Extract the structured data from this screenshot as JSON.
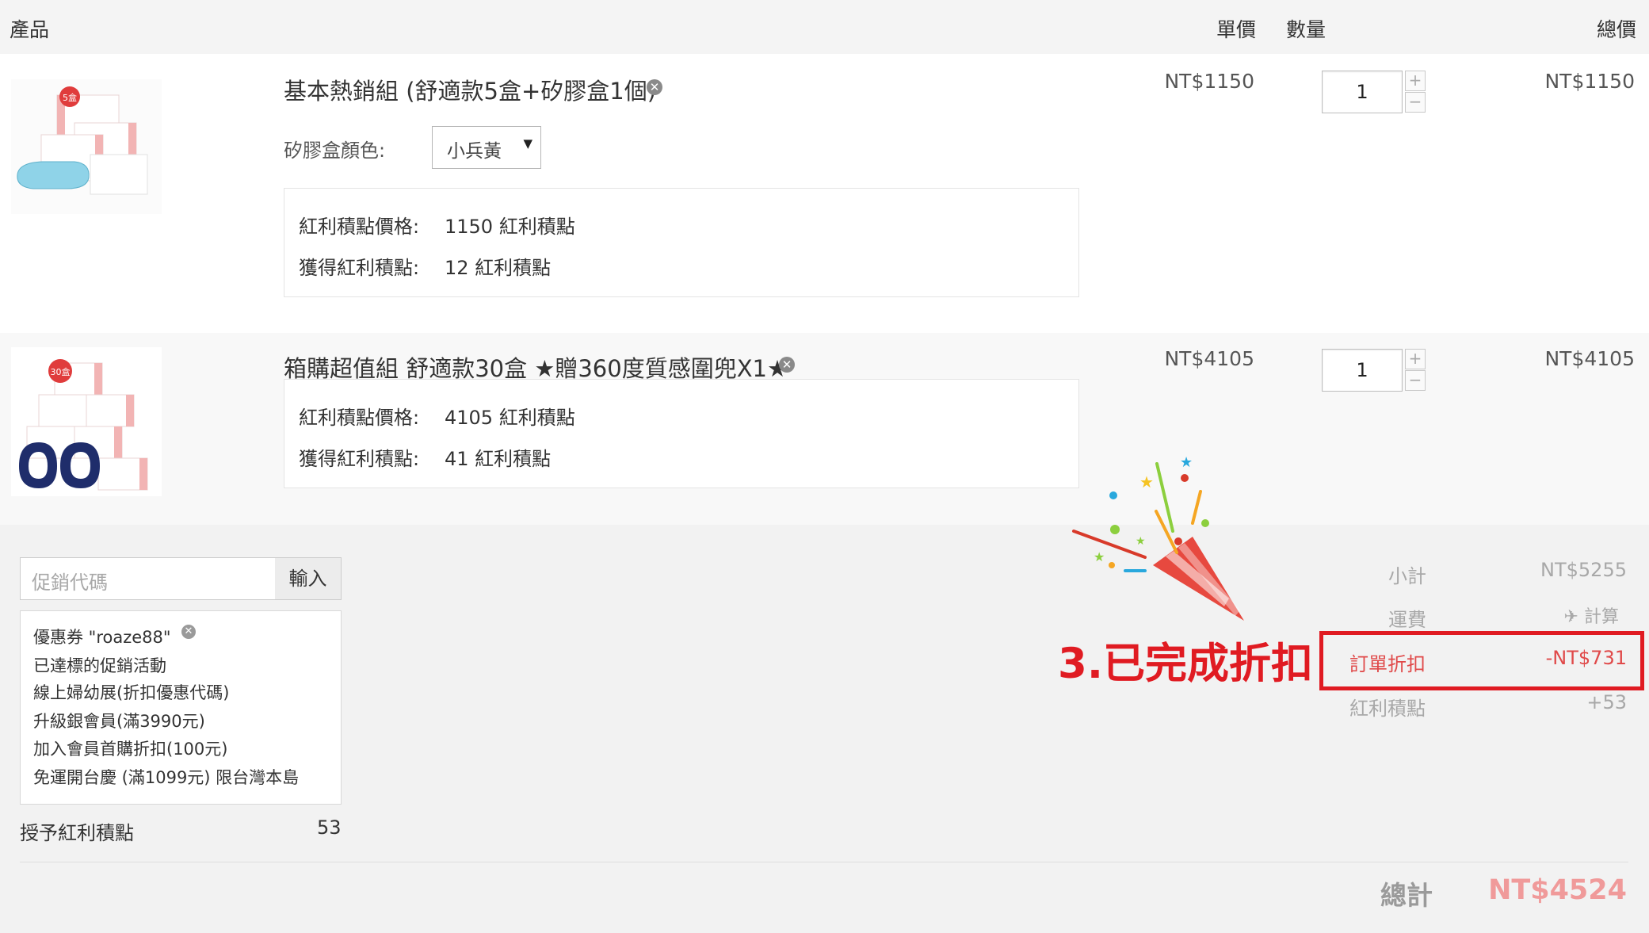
{
  "header": {
    "product_col": "產品",
    "unit_price_col": "單價",
    "quantity_col": "數量",
    "total_col": "總價"
  },
  "cart_items": [
    {
      "title": "基本熱銷組 (舒適款5盒+矽膠盒1個)",
      "unit_price": "NT$1150",
      "quantity": "1",
      "total": "NT$1150",
      "badge": "5盒",
      "option_label": "矽膠盒顏色:",
      "option_value": "小兵黃",
      "points_price_label": "紅利積點價格:",
      "points_price_value": "1150 紅利積點",
      "points_earned_label": "獲得紅利積點:",
      "points_earned_value": "12 紅利積點"
    },
    {
      "title": "箱購超值組 舒適款30盒 ★贈360度質感圍兜X1★",
      "unit_price": "NT$4105",
      "quantity": "1",
      "total": "NT$4105",
      "badge": "30盒",
      "points_price_label": "紅利積點價格:",
      "points_price_value": "4105 紅利積點",
      "points_earned_label": "獲得紅利積點:",
      "points_earned_value": "41 紅利積點"
    }
  ],
  "promo": {
    "placeholder": "促銷代碼",
    "apply_label": "輸入",
    "coupon": "優惠券 \"roaze88\"",
    "reached_title": "已達標的促銷活動",
    "activities": [
      "線上婦幼展(折扣優惠代碼)",
      "升級銀會員(滿3990元)",
      "加入會員首購折扣(100元)",
      "免運開台慶 (滿1099元) 限台灣本島"
    ],
    "bonus_label": "授予紅利積點",
    "bonus_value": "53"
  },
  "summary": {
    "subtotal_label": "小計",
    "subtotal_value": "NT$5255",
    "shipping_label": "運費",
    "shipping_value": "計算",
    "discount_label": "訂單折扣",
    "discount_value": "-NT$731",
    "points_label": "紅利積點",
    "points_value": "+53",
    "total_label": "總計",
    "total_value": "NT$4524"
  },
  "annotation": "3.已完成折扣",
  "icons": {
    "remove": "remove-circle-icon",
    "shipping": "airplane-icon",
    "celebration": "party-popper-icon"
  },
  "colors": {
    "accent_red": "#e01b22",
    "total_pink": "#f09a9a",
    "discount_red": "#e04a4a"
  }
}
